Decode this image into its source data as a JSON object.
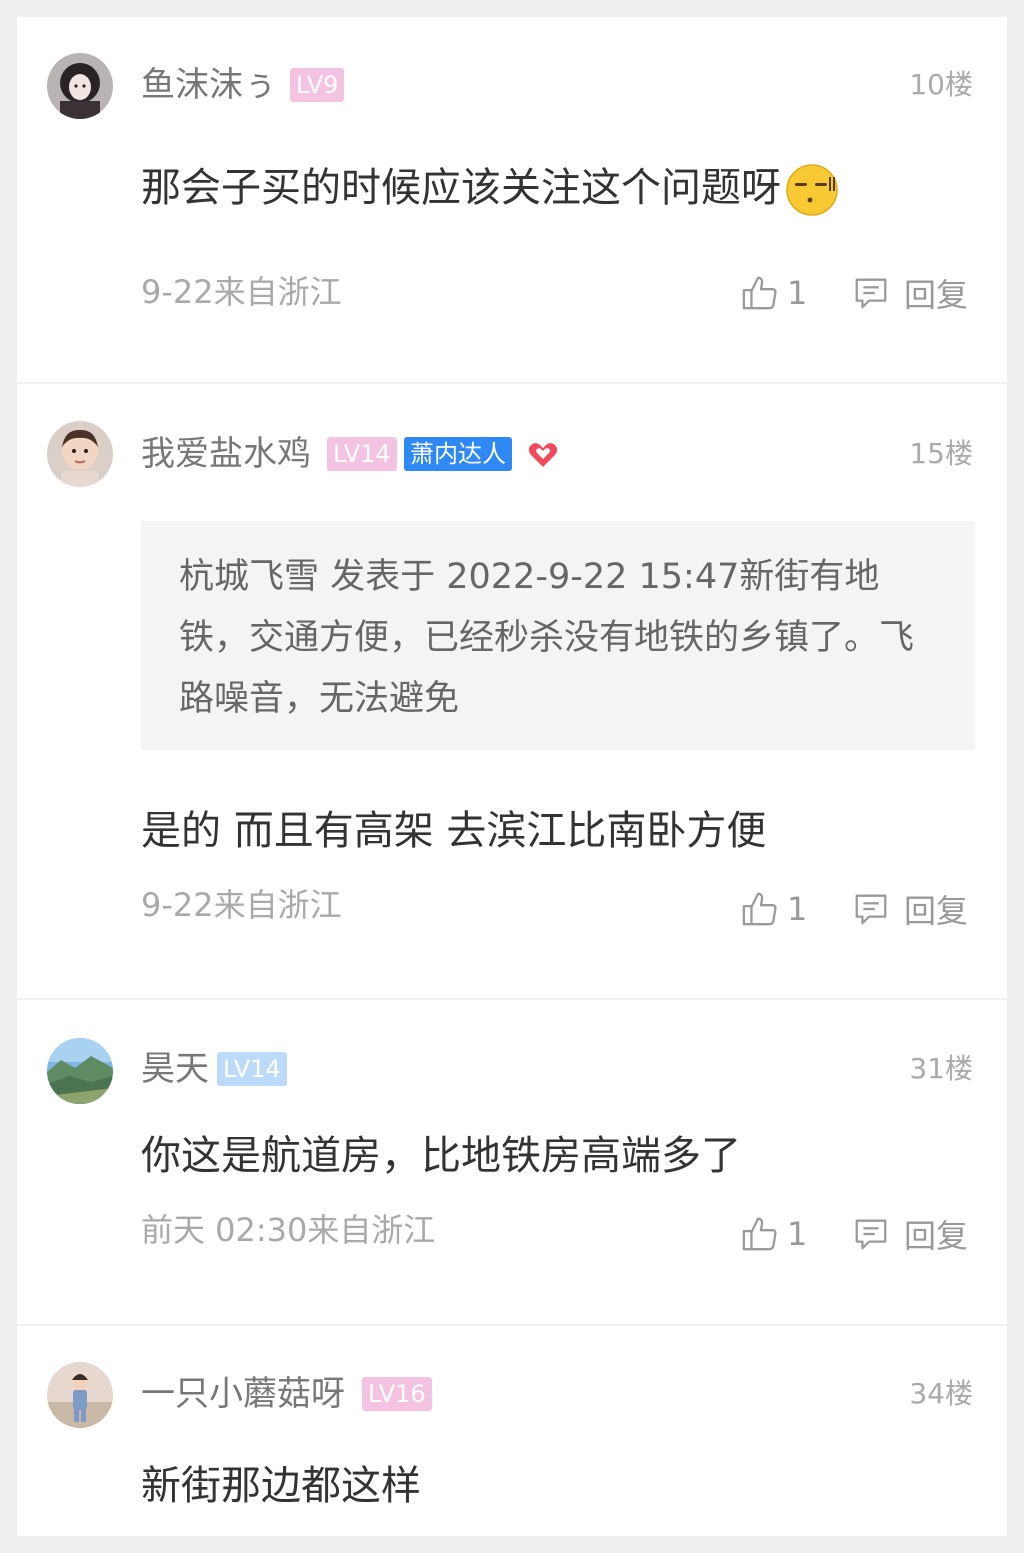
{
  "comments": [
    {
      "username": "鱼沫沫ぅ",
      "level": "LV9",
      "floor": "10楼",
      "content": "那会子买的时候应该关注这个问题呀",
      "emoji": "awkward-face",
      "meta": "9-22来自浙江",
      "likes": "1",
      "reply_label": "回复"
    },
    {
      "username": "我爱盐水鸡",
      "level": "LV14",
      "talent_badge": "萧内达人",
      "floor": "15楼",
      "quote": "杭城飞雪 发表于 2022-9-22 15:47新街有地铁，交通方便，已经秒杀没有地铁的乡镇了。飞路噪音，无法避免",
      "content": "是的 而且有高架 去滨江比南卧方便",
      "meta": "9-22来自浙江",
      "likes": "1",
      "reply_label": "回复"
    },
    {
      "username": "昊天",
      "level": "LV14",
      "floor": "31楼",
      "content": "你这是航道房，比地铁房高端多了",
      "meta": "前天 02:30来自浙江",
      "likes": "1",
      "reply_label": "回复"
    },
    {
      "username": "一只小蘑菇呀",
      "level": "LV16",
      "floor": "34楼",
      "content": "新街那边都这样"
    }
  ],
  "colors": {
    "level_pink": "#f5c3e2",
    "level_blue": "#bcdaf9",
    "talent_blue": "#2f89f5",
    "heart_red": "#f04a5b"
  }
}
